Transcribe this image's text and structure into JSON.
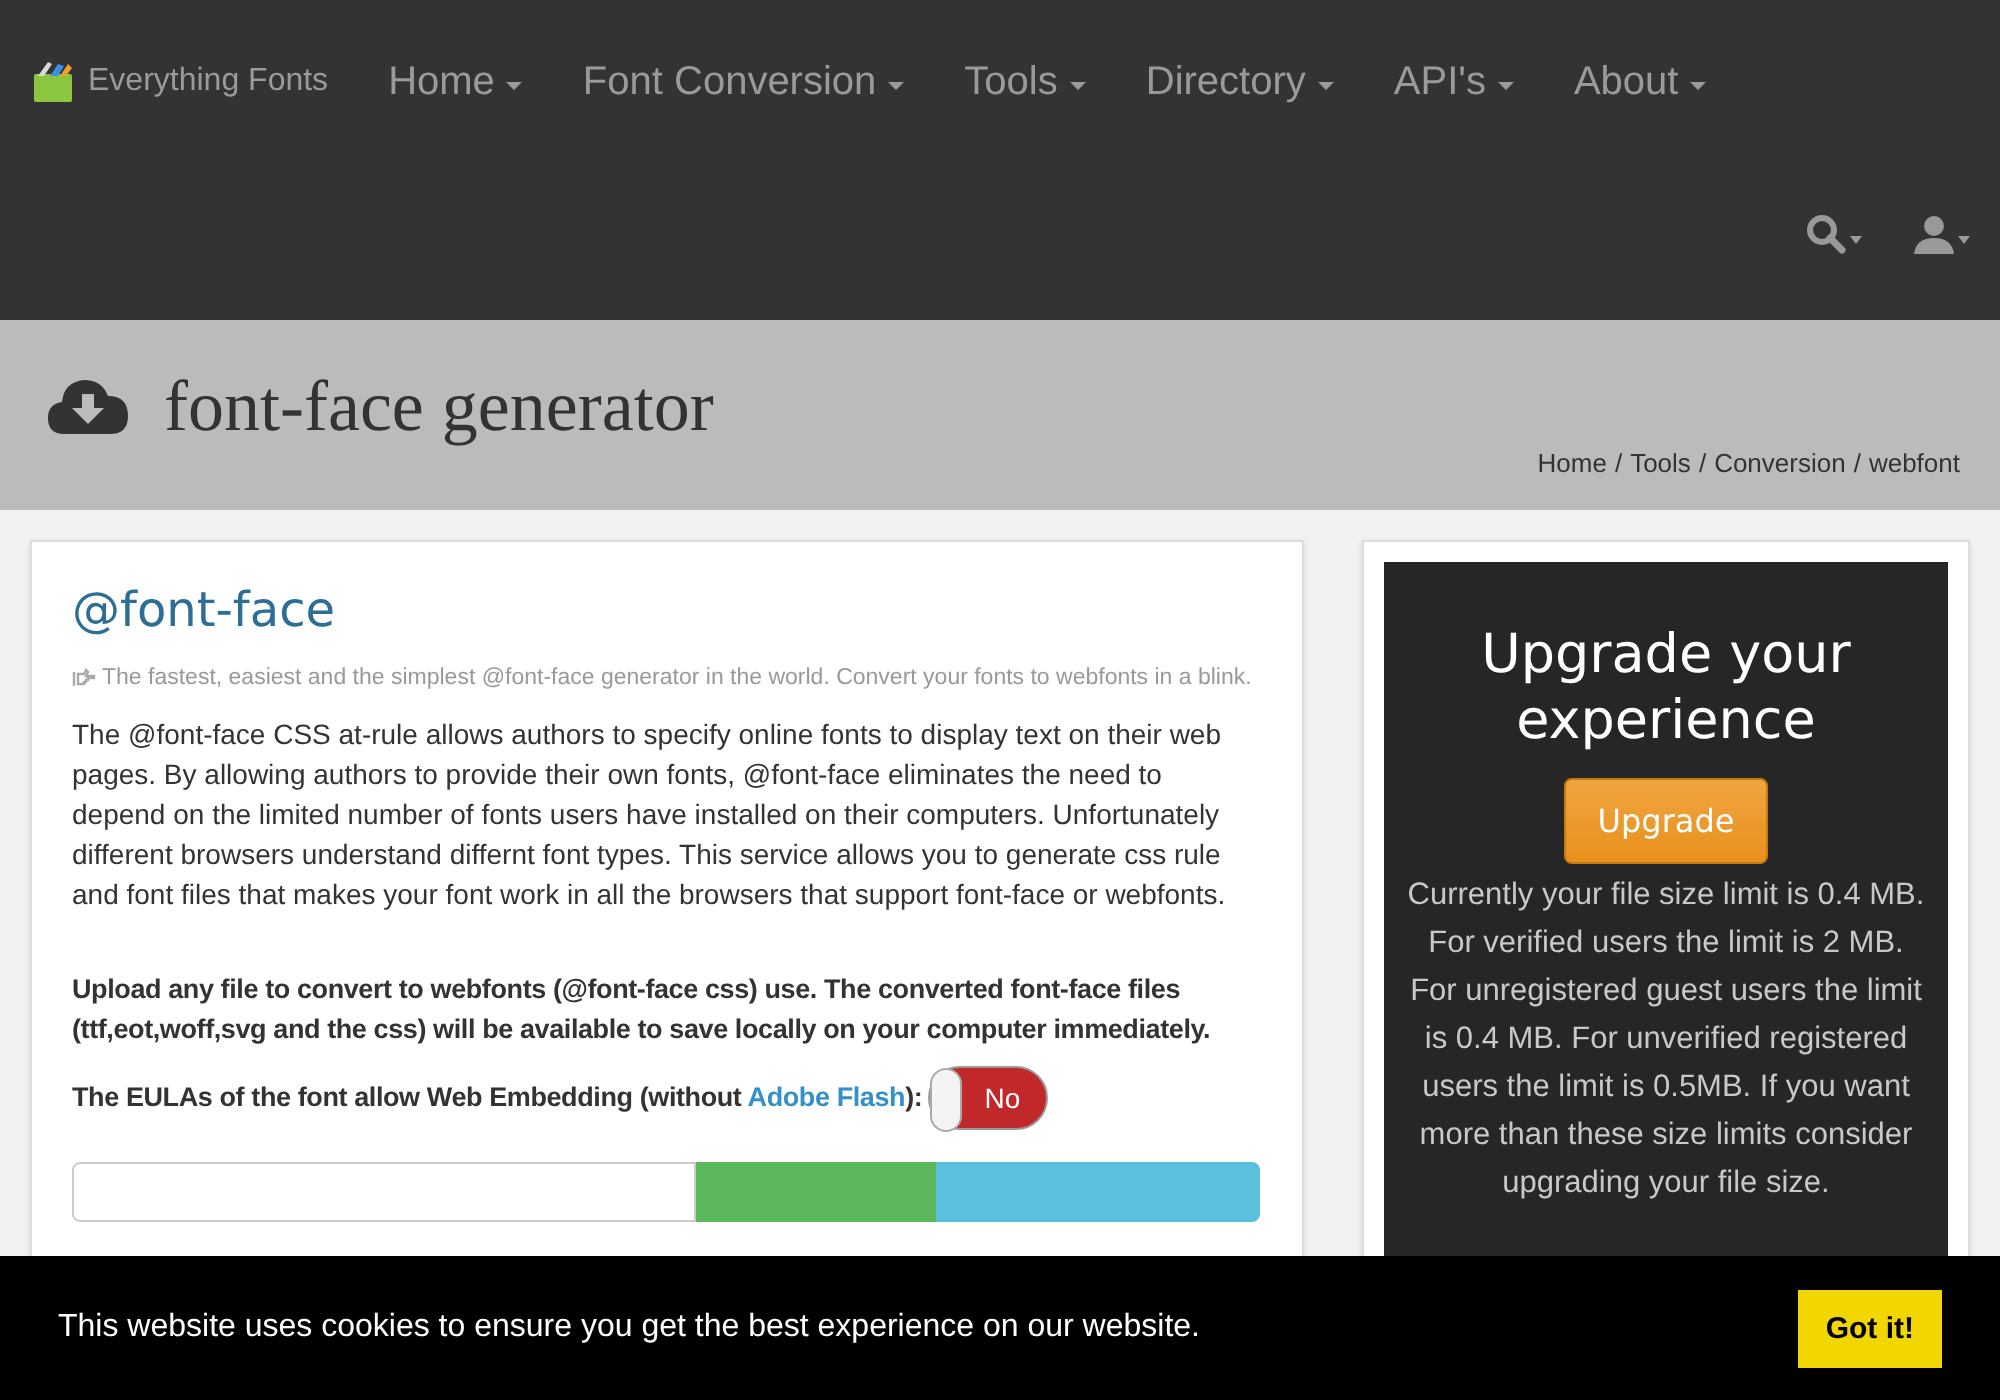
{
  "navbar": {
    "brand": "Everything Fonts",
    "items": [
      {
        "label": "Home"
      },
      {
        "label": "Font Conversion"
      },
      {
        "label": "Tools"
      },
      {
        "label": "Directory"
      },
      {
        "label": "API's"
      },
      {
        "label": "About"
      }
    ]
  },
  "header": {
    "title": "font-face generator",
    "breadcrumb": [
      "Home",
      "Tools",
      "Conversion",
      "webfont"
    ],
    "breadcrumb_separator": "/"
  },
  "main": {
    "heading": "@font-face",
    "tagline": "The fastest, easiest and the simplest @font-face generator in the world. Convert your fonts to webfonts in a blink.",
    "description": "The @font-face CSS at-rule allows authors to specify online fonts to display text on their web pages. By allowing authors to provide their own fonts, @font-face eliminates the need to depend on the limited number of fonts users have installed on their computers. Unfortunately different browsers understand differnt font types. This service allows you to generate css rule and font files that makes your font work in all the browsers that support font-face or webfonts.",
    "upload_note": "Upload any file to convert to webfonts (@font-face css) use. The converted font-face files (ttf,eot,woff,svg and the css) will be available to save locally on your computer immediately.",
    "eula": {
      "before": "The EULAs of the font allow Web Embedding (without ",
      "link": "Adobe Flash",
      "after": "):",
      "toggle": {
        "label": "No",
        "on": false
      }
    }
  },
  "sidebar": {
    "title": "Upgrade your experience",
    "button": "Upgrade",
    "text": "Currently your file size limit is 0.4 MB. For verified users the limit is 2 MB. For unregistered guest users the limit is 0.4 MB. For unverified registered users the limit is 0.5MB. If you want more than these size limits consider upgrading your file size."
  },
  "cookie_bar": {
    "message": "This website uses cookies to ensure you get the best experience on our website.",
    "button": "Got it!"
  }
}
